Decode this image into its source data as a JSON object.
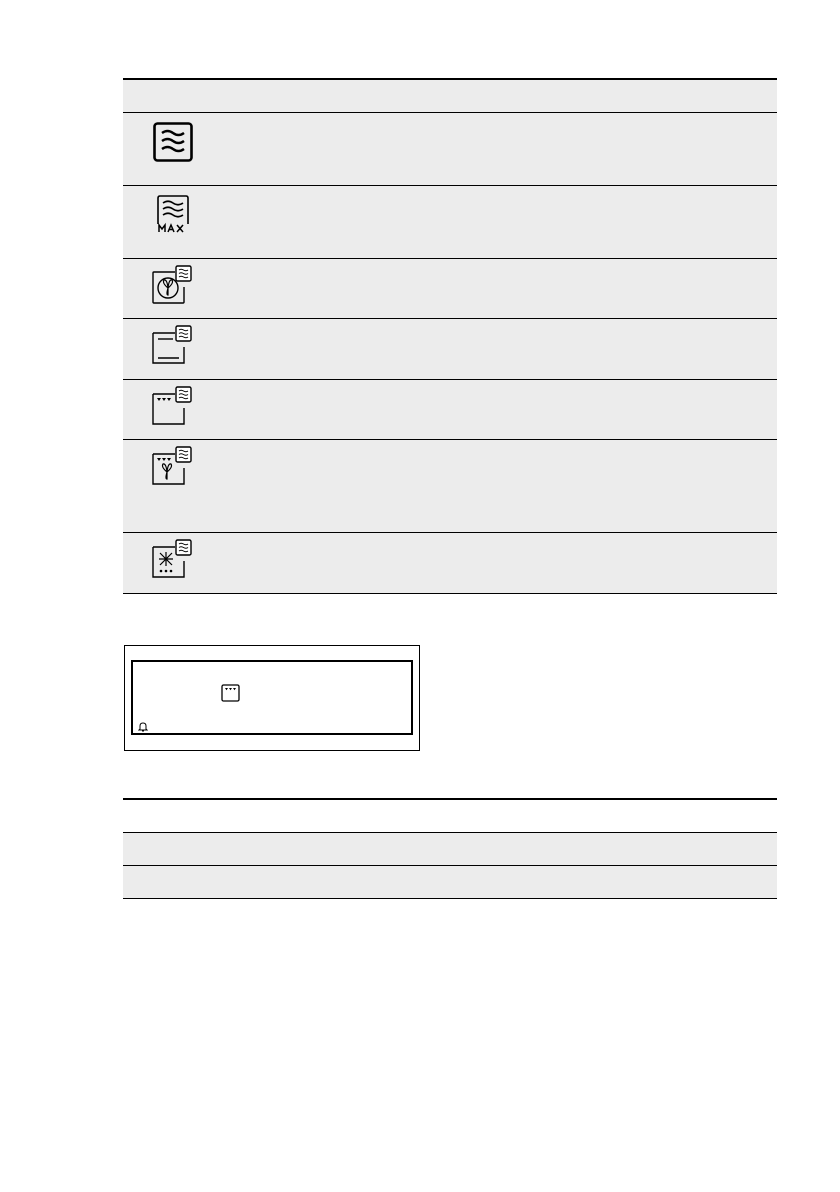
{
  "mode_table": {
    "icons": [
      "microwave-icon",
      "microwave-max-icon",
      "fan-microwave-icon",
      "top-bottom-heat-microwave-icon",
      "grill-microwave-icon",
      "grill-fan-microwave-icon",
      "defrost-microwave-icon"
    ],
    "colors": {
      "row_fill": "#ececec",
      "rule": "#000000"
    }
  },
  "display": {
    "icons": [
      "oven-grill-icon",
      "bell-icon"
    ]
  },
  "bottom_table": {
    "rows": 2,
    "colors": {
      "row_fill": "#ececec"
    }
  }
}
